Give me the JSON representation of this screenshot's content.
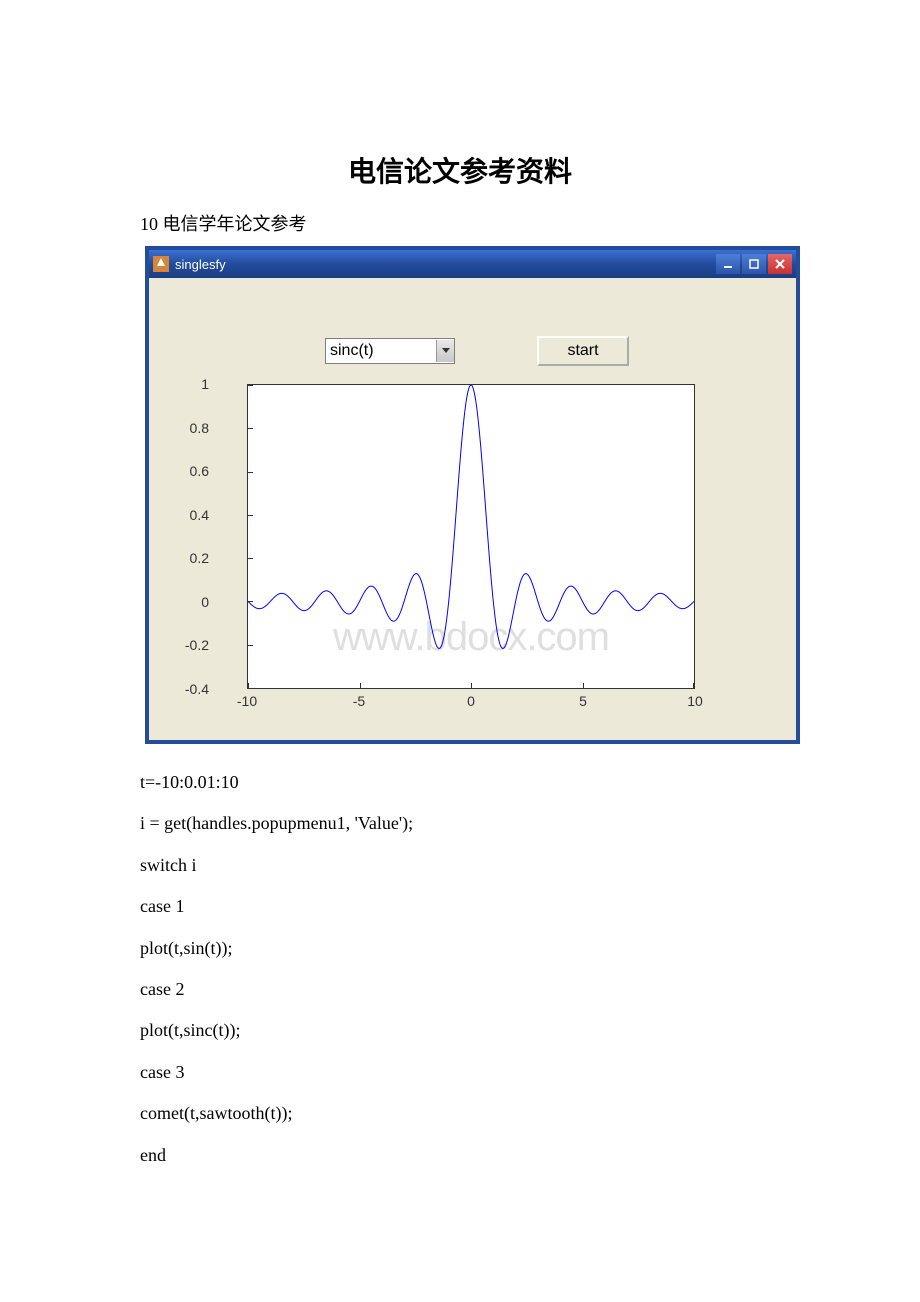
{
  "page_title": "电信论文参考资料",
  "subtitle": "10 电信学年论文参考",
  "window": {
    "title": "singlesfy",
    "dropdown_value": "sinc(t)",
    "start_label": "start"
  },
  "watermark": "www.bdocx.com",
  "chart_data": {
    "type": "line",
    "title": "",
    "xlabel": "",
    "ylabel": "",
    "xlim": [
      -10,
      10
    ],
    "ylim": [
      -0.4,
      1
    ],
    "x_ticks": [
      -10,
      -5,
      0,
      5,
      10
    ],
    "y_ticks": [
      -0.4,
      -0.2,
      0,
      0.2,
      0.4,
      0.6,
      0.8,
      1
    ],
    "function": "sinc(t)",
    "t_range": "-10:0.01:10",
    "series": [
      {
        "name": "sinc(t)",
        "color": "#0000ff"
      }
    ]
  },
  "code_lines": [
    "t=-10:0.01:10",
    "i = get(handles.popupmenu1, 'Value');",
    "switch i",
    " case 1",
    " plot(t,sin(t));",
    " case 2",
    " plot(t,sinc(t));",
    " case 3",
    " comet(t,sawtooth(t));",
    "end"
  ]
}
